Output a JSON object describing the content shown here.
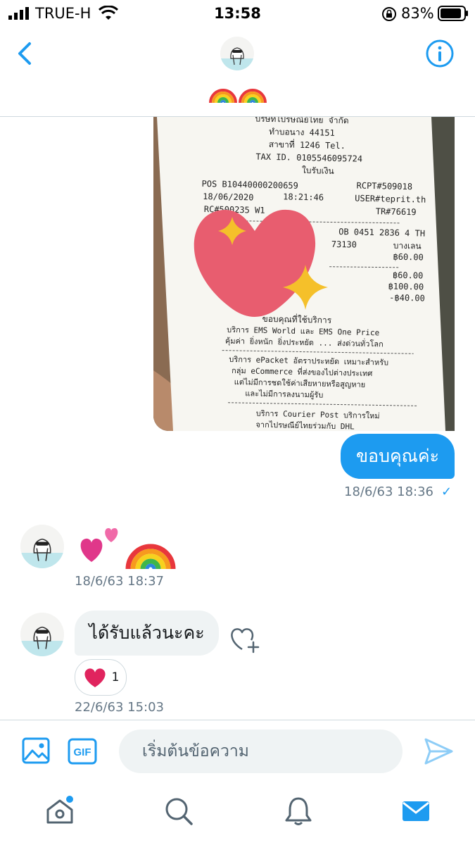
{
  "status_bar": {
    "carrier": "TRUE-H",
    "time": "13:58",
    "battery": "83%"
  },
  "header": {
    "back_icon": "chevron-left-icon",
    "info_icon": "info-icon",
    "name_emoji": "🌈🌈"
  },
  "receipt": {
    "lines": [
      "บริษัทไปรษณีย์ไทย จำกัด",
      "ทำบอนาง 44151",
      "สาขาที่ 1246 Tel.",
      "TAX ID. 0105546095724",
      "ใบรับเงิน",
      "POS B10440000200659",
      "RCPT#509018",
      "18/06/2020",
      "18:21:46",
      "USER#teprit.th",
      "RC#500235 W1",
      "TR#76619",
      "OB 0451 2836 4 TH",
      "73130",
      "บางเลน",
      "฿60.00",
      "฿60.00",
      "฿100.00",
      "-฿40.00",
      "ขอบคุณที่ใช้บริการ",
      "บริการ EMS World และ EMS One Price",
      "คุ้มค่า ยิ่งหนัก ยิ่งประหยัด ... ส่งด่วนทั่วโลก",
      "บริการ ePacket อัตราประหยัด เหมาะสำหรับ",
      "กลุ่ม eCommerce ที่ส่งของไปต่างประเทศ",
      "แต่ไม่มีการชดใช้ค่าเสียหายหรือสูญหาย",
      "และไม่มีการลงนามผู้รับ",
      "บริการ Courier Post บริการใหม่",
      "จากไปรษณีย์ไทยร่วมกับ DHL"
    ]
  },
  "messages": {
    "sent_text": "ขอบคุณค่ะ",
    "sent_time": "18/6/63 18:36",
    "sent_check": "✓",
    "received_emoji_time": "18/6/63 18:37",
    "received_text": "ได้รับแล้วนะคะ",
    "reaction_count": "1",
    "received_text_time": "22/6/63 15:03"
  },
  "composer": {
    "placeholder": "เริ่มต้นข้อความ",
    "gif_label": "GIF"
  },
  "colors": {
    "accent": "#1d9bf0",
    "reaction_heart": "#e0245e",
    "sticker_heart": "#e85d6f",
    "sparkle": "#f5c02a"
  }
}
